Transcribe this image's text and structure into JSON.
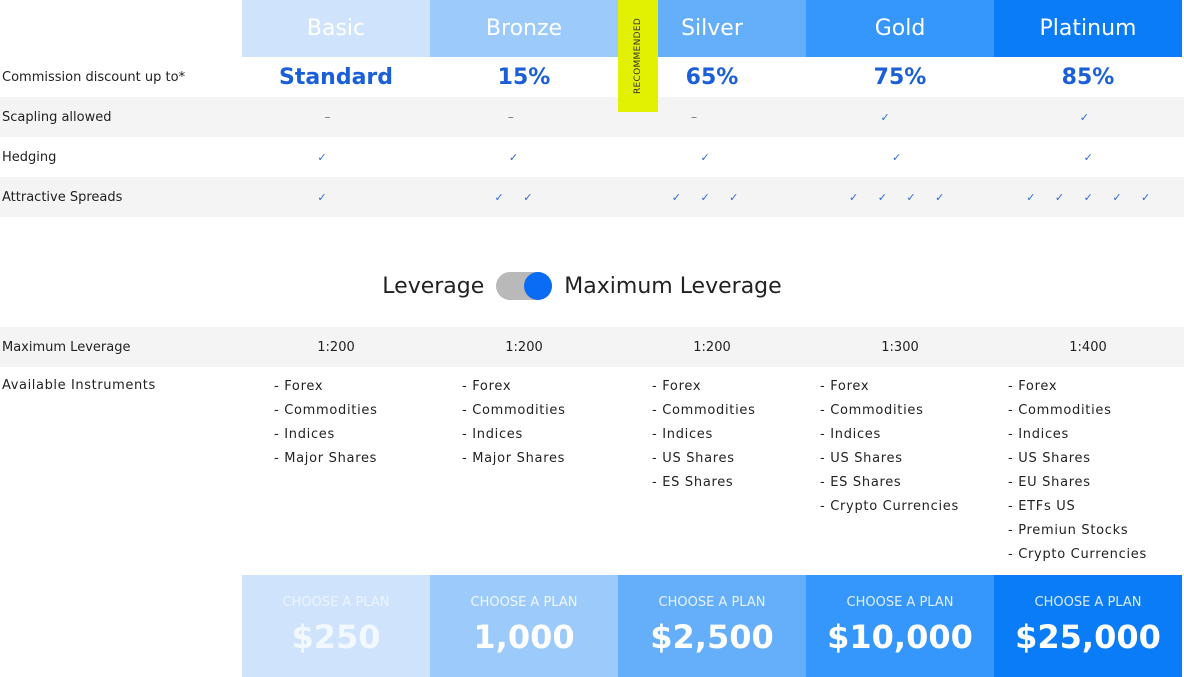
{
  "tiers": [
    "Basic",
    "Bronze",
    "Silver",
    "Gold",
    "Platinum"
  ],
  "badge": "RECOMMENDED",
  "rows": {
    "commission": {
      "label": "Commission discount up to*",
      "values": [
        "Standard",
        "15%",
        "65%",
        "75%",
        "85%"
      ]
    },
    "scalping": {
      "label": "Scapling allowed",
      "values": [
        "–",
        "–",
        "–",
        "✓",
        "✓"
      ]
    },
    "hedging": {
      "label": "Hedging",
      "values": [
        "✓",
        "✓",
        "✓",
        "✓",
        "✓"
      ]
    },
    "spreads": {
      "label": "Attractive Spreads",
      "values": [
        "✓",
        "✓ ✓",
        "✓ ✓ ✓",
        "✓ ✓ ✓ ✓",
        "✓ ✓ ✓ ✓ ✓"
      ]
    }
  },
  "toggle": {
    "left_label": "Leverage",
    "right_label": "Maximum Leverage",
    "state": "on"
  },
  "leverage": {
    "label": "Maximum Leverage",
    "values": [
      "1:200",
      "1:200",
      "1:200",
      "1:300",
      "1:400"
    ]
  },
  "instruments": {
    "label": "Available Instruments",
    "columns": [
      [
        "Forex",
        "Commodities",
        "Indices",
        "Major Shares"
      ],
      [
        "Forex",
        "Commodities",
        "Indices",
        "Major Shares"
      ],
      [
        "Forex",
        "Commodities",
        "Indices",
        "US Shares",
        "ES Shares"
      ],
      [
        "Forex",
        "Commodities",
        "Indices",
        "US Shares",
        "ES Shares",
        "Crypto Currencies"
      ],
      [
        "Forex",
        "Commodities",
        "Indices",
        "US Shares",
        "EU Shares",
        "ETFs US",
        "Premiun Stocks",
        "Crypto Currencies"
      ]
    ]
  },
  "plans": [
    {
      "cta": "CHOOSE A PLAN",
      "price": "$250"
    },
    {
      "cta": "CHOOSE A PLAN",
      "price": "1,000"
    },
    {
      "cta": "CHOOSE A PLAN",
      "price": "$2,500"
    },
    {
      "cta": "CHOOSE A PLAN",
      "price": "$10,000"
    },
    {
      "cta": "CHOOSE A PLAN",
      "price": "$25,000"
    }
  ],
  "colors": {
    "tier_colors": [
      "#cfe4fc",
      "#9ccafb",
      "#64aefa",
      "#3596fb",
      "#0a7cf8"
    ],
    "accent": "#1a5fd8",
    "badge": "#e2f001"
  }
}
